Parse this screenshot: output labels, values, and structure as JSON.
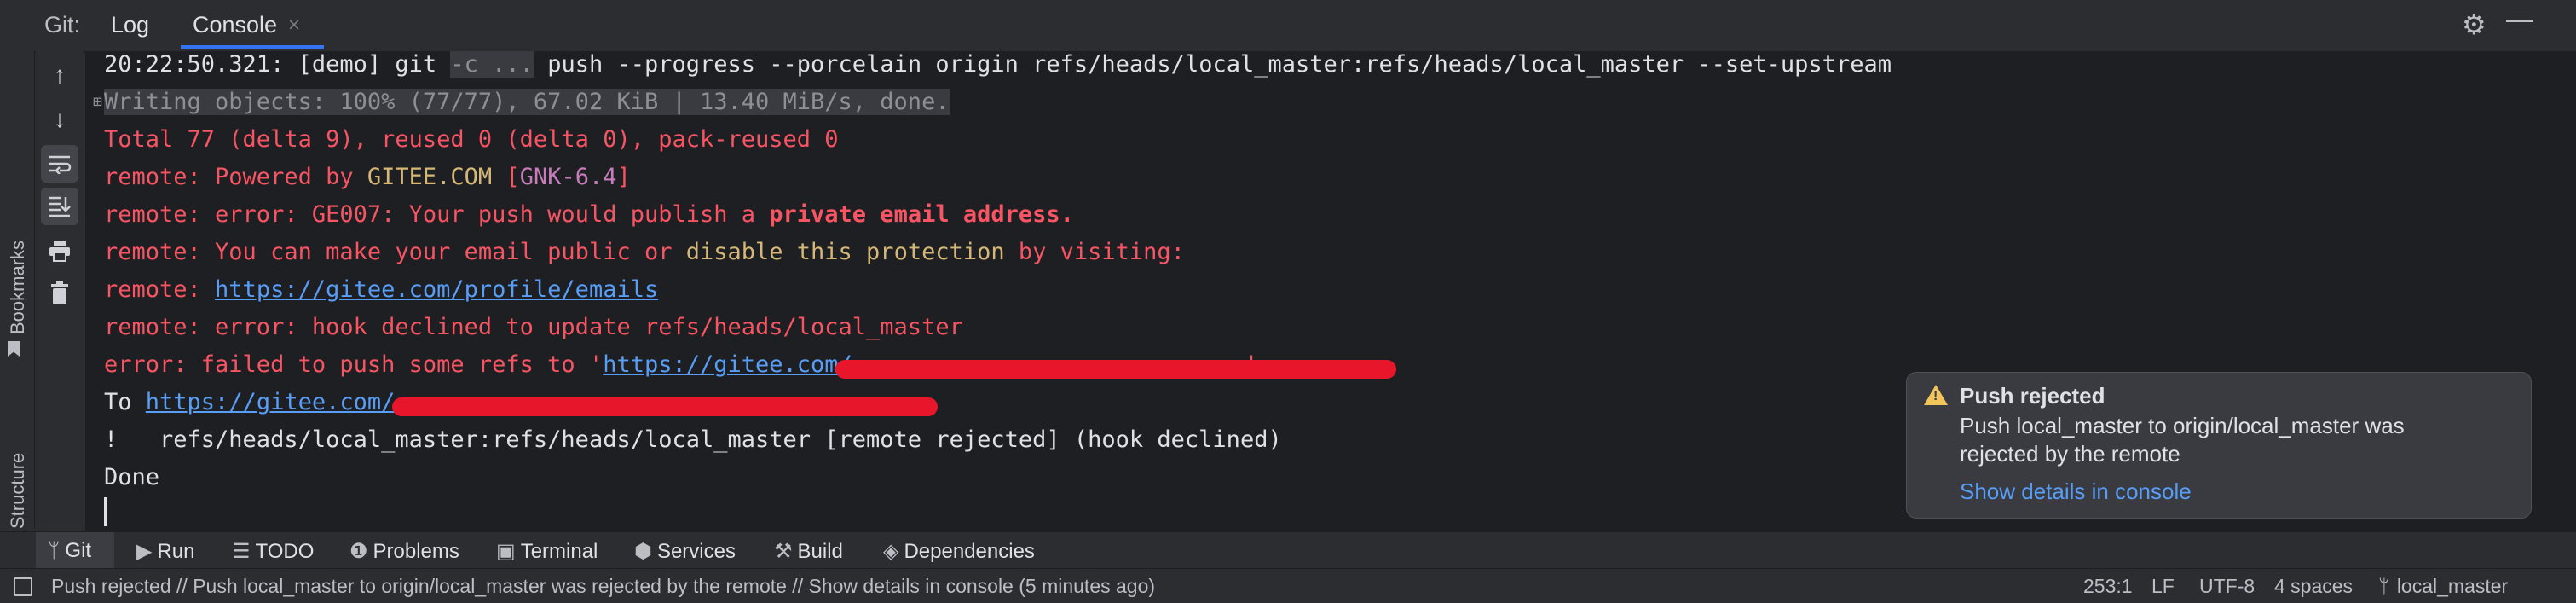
{
  "header": {
    "tool_label": "Git:",
    "tabs": [
      {
        "label": "Log"
      },
      {
        "label": "Console",
        "active": true
      }
    ],
    "close_glyph": "×"
  },
  "left_panels": [
    {
      "label": "Bookmarks"
    },
    {
      "label": "Structure"
    }
  ],
  "console_lines": {
    "l0": {
      "time": "20:22:50.321: [demo] git ",
      "flag": "-c ...",
      "rest": " push --progress --porcelain origin refs/heads/local_master:refs/heads/local_master --set-upstream"
    },
    "l1": {
      "text": "Writing objects: 100% (77/77), 67.02 KiB | 13.40 MiB/s, done."
    },
    "l2": {
      "text": "Total 77 (delta 9), reused 0 (delta 0), pack-reused 0"
    },
    "l3": {
      "prefix": "remote: Powered by ",
      "brand": "GITEE.COM",
      "sp": " ",
      "bracket_open": "[",
      "version": "GNK-6.4",
      "bracket_close": "]"
    },
    "l4": {
      "prefix": "remote: error: GE007: Your push would publish a ",
      "bold": "private email address."
    },
    "l5": {
      "prefix": "remote: You can make your email public or ",
      "highlight": "disable this protection",
      "suffix": " by visiting:"
    },
    "l6": {
      "prefix": "remote: ",
      "link": "https://gitee.com/profile/emails"
    },
    "l7": {
      "text": "remote: error: hook declined to update refs/heads/local_master"
    },
    "l8": {
      "prefix": "error: failed to push some refs to '",
      "link": "https://gitee.com/",
      "suffix": "'"
    },
    "l9": {
      "prefix": "To ",
      "link": "https://gitee.com/"
    },
    "l10": {
      "text": "!   refs/heads/local_master:refs/heads/local_master [remote rejected] (hook declined)"
    },
    "l11": {
      "text": "Done"
    }
  },
  "notification": {
    "title": "Push rejected",
    "body": "Push local_master to origin/local_master was rejected by the remote",
    "link": "Show details in console"
  },
  "bottom_tabs": [
    {
      "label": "Git",
      "icon": "git-branch-icon",
      "active": true
    },
    {
      "label": "Run",
      "icon": "play-icon"
    },
    {
      "label": "TODO",
      "icon": "list-icon"
    },
    {
      "label": "Problems",
      "icon": "warning-icon"
    },
    {
      "label": "Terminal",
      "icon": "terminal-icon"
    },
    {
      "label": "Services",
      "icon": "services-icon"
    },
    {
      "label": "Build",
      "icon": "hammer-icon"
    },
    {
      "label": "Dependencies",
      "icon": "layers-icon"
    }
  ],
  "status_bar": {
    "message": "Push rejected // Push local_master to origin/local_master was rejected by the remote // Show details in console (5 minutes ago)",
    "position": "253:1",
    "line_ending": "LF",
    "encoding": "UTF-8",
    "indent": "4 spaces",
    "branch": "local_master"
  },
  "colors": {
    "accent": "#3574f0",
    "error_text": "#f75464",
    "link": "#589df6",
    "warning": "#f2c55c"
  }
}
